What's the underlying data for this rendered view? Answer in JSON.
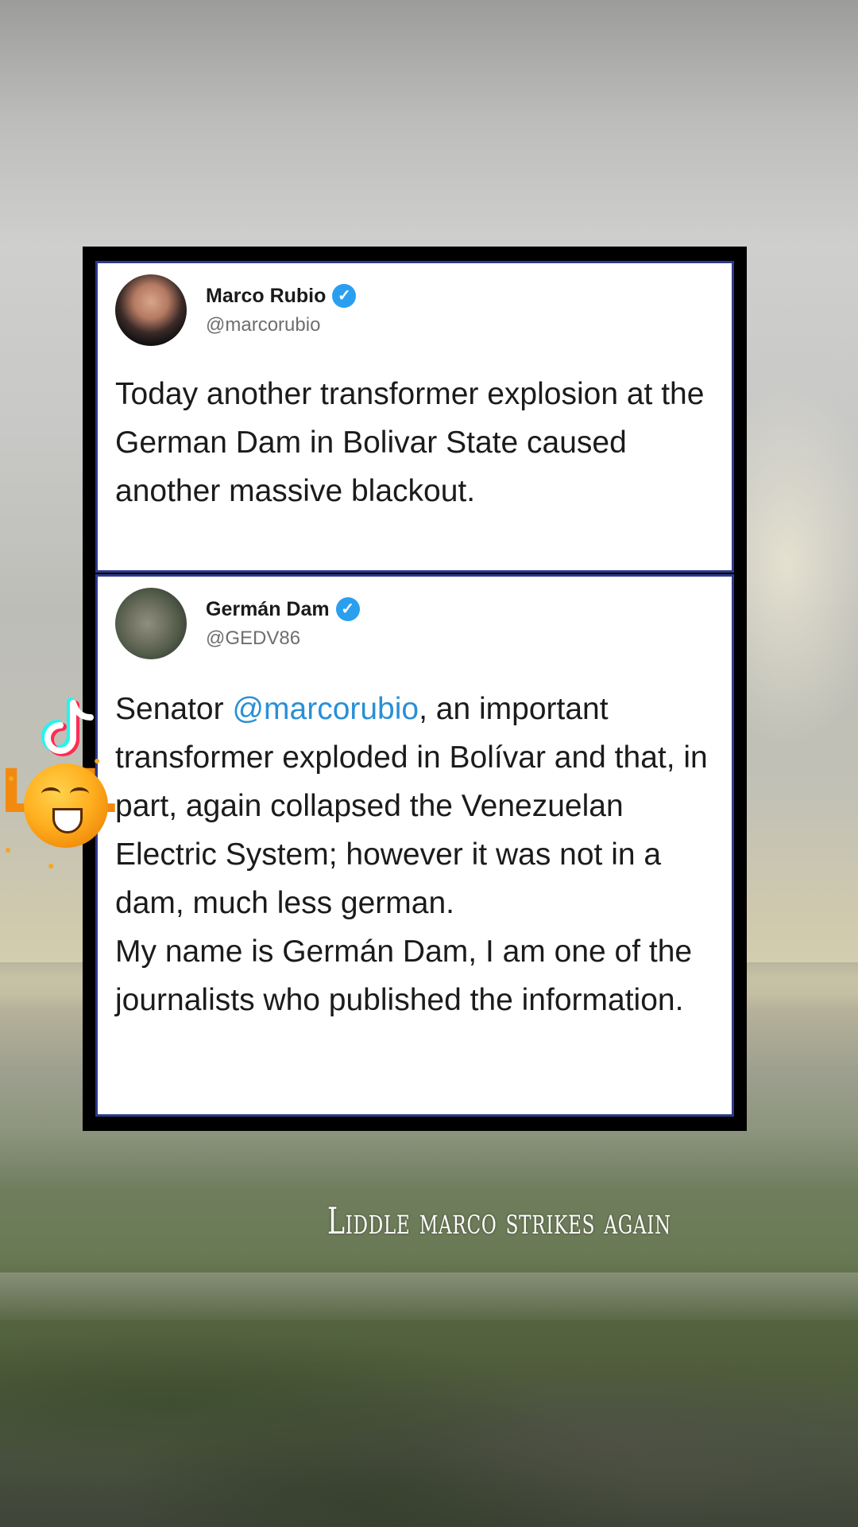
{
  "tweets": [
    {
      "author_name": "Marco Rubio",
      "handle": "@marcorubio",
      "verified_icon": "verified-badge-icon",
      "text": "Today another transformer explosion at the German Dam in Bolivar State caused another massive blackout."
    },
    {
      "author_name": "Germán Dam",
      "handle": "@GEDV86",
      "verified_icon": "verified-badge-icon",
      "text_pre_mention": "Senator ",
      "mention": "@marcorubio",
      "text_post_mention": ", an important transformer exploded in Bolívar and that, in part, again collapsed the Venezuelan Electric System; however it was not in a dam, much less german.",
      "text_second_paragraph": "My name is Germán Dam, I am one of the journalists who published the information."
    }
  ],
  "overlay": {
    "caption": "Liddle marco strikes again",
    "sticker_text": "LOL",
    "app_logo_icon": "tiktok-logo-icon",
    "accent_color": "#2a8fd6",
    "verified_color": "#2a9ff0",
    "sticker_color": "#f28a10"
  }
}
